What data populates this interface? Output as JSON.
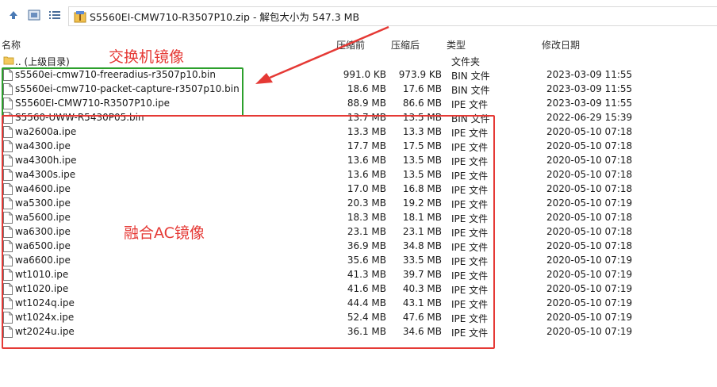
{
  "window": {
    "path": "S5560EI-CMW710-R3507P10.zip - 解包大小为 547.3 MB",
    "icons": [
      "arrow-up-icon",
      "view-icon",
      "list-icon",
      "zip-icon"
    ]
  },
  "columns": {
    "name": "名称",
    "original": "压缩前",
    "compressed": "压缩后",
    "type": "类型",
    "modified": "修改日期"
  },
  "parent": {
    "name": ".. (上级目录)",
    "type": "文件夹"
  },
  "files": [
    {
      "name": "s5560ei-cmw710-freeradius-r3507p10.bin",
      "orig": "991.0 KB",
      "comp": "973.9 KB",
      "type": "BIN 文件",
      "date": "2023-03-09 11:55"
    },
    {
      "name": "s5560ei-cmw710-packet-capture-r3507p10.bin",
      "orig": "18.6 MB",
      "comp": "17.6 MB",
      "type": "BIN 文件",
      "date": "2023-03-09 11:55"
    },
    {
      "name": "S5560EI-CMW710-R3507P10.ipe",
      "orig": "88.9 MB",
      "comp": "86.6 MB",
      "type": "IPE 文件",
      "date": "2023-03-09 11:55"
    },
    {
      "name": "S5560-UWW-R5430P05.bin",
      "orig": "13.7 MB",
      "comp": "13.5 MB",
      "type": "BIN 文件",
      "date": "2022-06-29 15:39"
    },
    {
      "name": "wa2600a.ipe",
      "orig": "13.3 MB",
      "comp": "13.3 MB",
      "type": "IPE 文件",
      "date": "2020-05-10 07:18"
    },
    {
      "name": "wa4300.ipe",
      "orig": "17.7 MB",
      "comp": "17.5 MB",
      "type": "IPE 文件",
      "date": "2020-05-10 07:18"
    },
    {
      "name": "wa4300h.ipe",
      "orig": "13.6 MB",
      "comp": "13.5 MB",
      "type": "IPE 文件",
      "date": "2020-05-10 07:18"
    },
    {
      "name": "wa4300s.ipe",
      "orig": "13.6 MB",
      "comp": "13.5 MB",
      "type": "IPE 文件",
      "date": "2020-05-10 07:18"
    },
    {
      "name": "wa4600.ipe",
      "orig": "17.0 MB",
      "comp": "16.8 MB",
      "type": "IPE 文件",
      "date": "2020-05-10 07:18"
    },
    {
      "name": "wa5300.ipe",
      "orig": "20.3 MB",
      "comp": "19.2 MB",
      "type": "IPE 文件",
      "date": "2020-05-10 07:19"
    },
    {
      "name": "wa5600.ipe",
      "orig": "18.3 MB",
      "comp": "18.1 MB",
      "type": "IPE 文件",
      "date": "2020-05-10 07:18"
    },
    {
      "name": "wa6300.ipe",
      "orig": "23.1 MB",
      "comp": "23.1 MB",
      "type": "IPE 文件",
      "date": "2020-05-10 07:18"
    },
    {
      "name": "wa6500.ipe",
      "orig": "36.9 MB",
      "comp": "34.8 MB",
      "type": "IPE 文件",
      "date": "2020-05-10 07:18"
    },
    {
      "name": "wa6600.ipe",
      "orig": "35.6 MB",
      "comp": "33.5 MB",
      "type": "IPE 文件",
      "date": "2020-05-10 07:19"
    },
    {
      "name": "wt1010.ipe",
      "orig": "41.3 MB",
      "comp": "39.7 MB",
      "type": "IPE 文件",
      "date": "2020-05-10 07:19"
    },
    {
      "name": "wt1020.ipe",
      "orig": "41.6 MB",
      "comp": "40.3 MB",
      "type": "IPE 文件",
      "date": "2020-05-10 07:19"
    },
    {
      "name": "wt1024q.ipe",
      "orig": "44.4 MB",
      "comp": "43.1 MB",
      "type": "IPE 文件",
      "date": "2020-05-10 07:19"
    },
    {
      "name": "wt1024x.ipe",
      "orig": "52.4 MB",
      "comp": "47.6 MB",
      "type": "IPE 文件",
      "date": "2020-05-10 07:19"
    },
    {
      "name": "wt2024u.ipe",
      "orig": "36.1 MB",
      "comp": "34.6 MB",
      "type": "IPE 文件",
      "date": "2020-05-10 07:19"
    }
  ],
  "annotations": {
    "switch_label": "交换机镜像",
    "ac_label": "融合AC镜像",
    "green": "#2ca02c",
    "red": "#e53935"
  }
}
